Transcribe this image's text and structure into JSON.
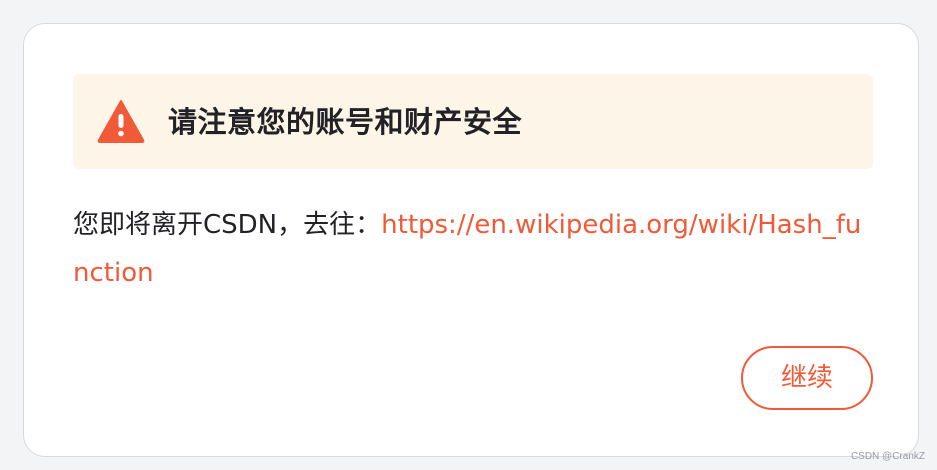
{
  "dialog": {
    "warning": {
      "icon": "warning-triangle-icon",
      "title": "请注意您的账号和财产安全"
    },
    "redirect": {
      "prefix": "您即将离开CSDN，去往：",
      "url": "https://en.wikipedia.org/wiki/Hash_function"
    },
    "continue_label": "继续"
  },
  "watermark": "CSDN @CrankZ",
  "colors": {
    "accent": "#f05a38",
    "banner_bg": "#fdf5e8",
    "text": "#222226"
  }
}
